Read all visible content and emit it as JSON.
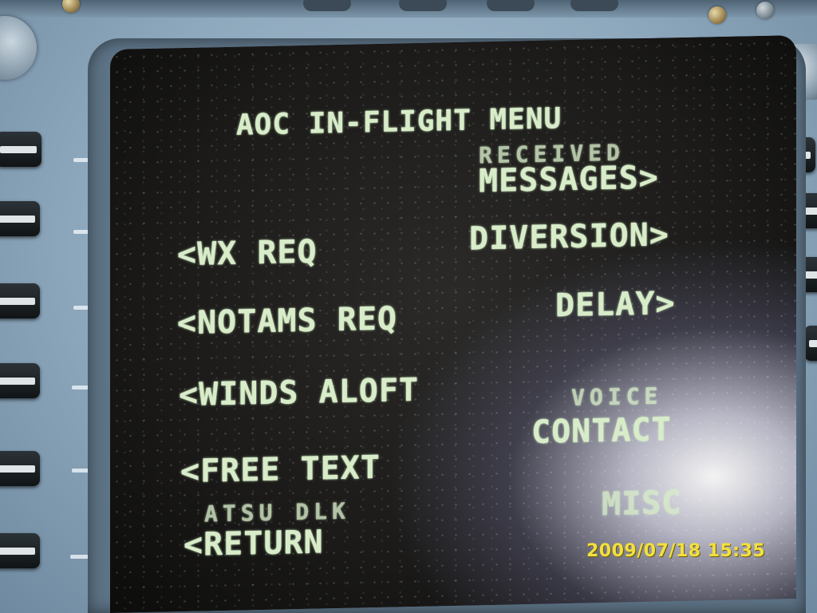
{
  "screen": {
    "title": "AOC IN-FLIGHT MENU",
    "left_items": [
      {
        "label": "<WX REQ"
      },
      {
        "label": "<NOTAMS REQ"
      },
      {
        "label": "<WINDS ALOFT"
      },
      {
        "label": "<FREE TEXT"
      },
      {
        "sublabel": "ATSU DLK",
        "label": "<RETURN"
      }
    ],
    "right_items": [
      {
        "sublabel": "RECEIVED",
        "label": "MESSAGES>"
      },
      {
        "label": "DIVERSION>"
      },
      {
        "label": "DELAY>"
      },
      {
        "sublabel": "VOICE",
        "label": "CONTACT"
      },
      {
        "label": "MISC"
      }
    ]
  },
  "timestamp": "2009/07/18 15:35",
  "colors": {
    "screen_text": "#d8ecc9",
    "bezel": "#8ea8bd",
    "timestamp": "#f2e040"
  },
  "icons": [
    "line-select-key"
  ]
}
